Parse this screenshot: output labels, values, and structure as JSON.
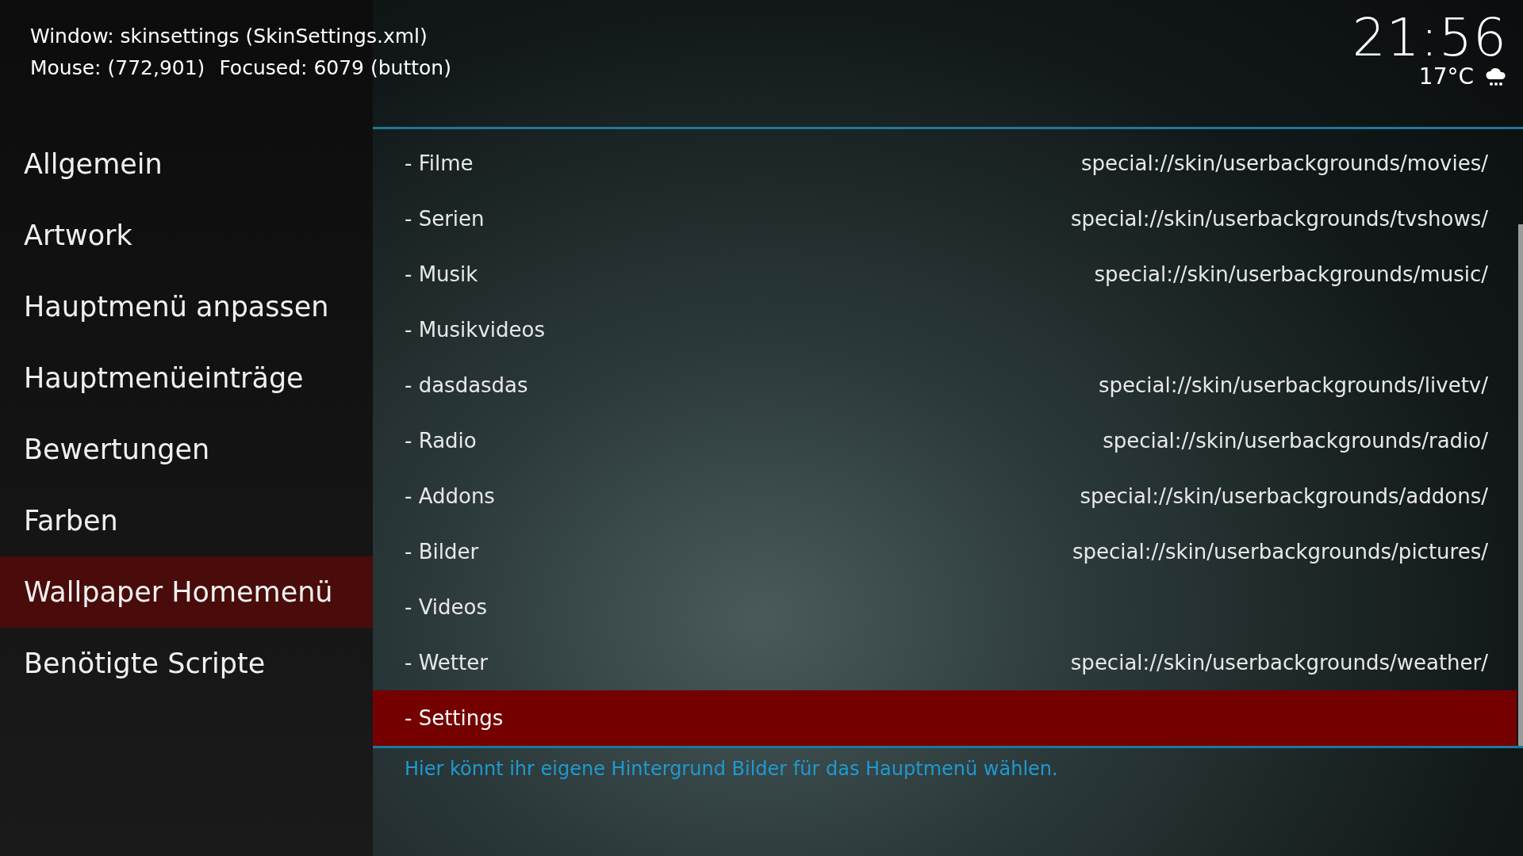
{
  "debug_overlay": {
    "window": "Window: skinsettings (SkinSettings.xml)",
    "mouse": "Mouse: (772,901)",
    "focused": "Focused: 6079 (button)"
  },
  "header": {
    "time": "21:56",
    "temperature": "17°C"
  },
  "sidebar": {
    "items": [
      {
        "label": "Allgemein",
        "selected": false
      },
      {
        "label": "Artwork",
        "selected": false
      },
      {
        "label": "Hauptmenü anpassen",
        "selected": false
      },
      {
        "label": "Hauptmenüeinträge",
        "selected": false
      },
      {
        "label": "Bewertungen",
        "selected": false
      },
      {
        "label": "Farben",
        "selected": false
      },
      {
        "label": "Wallpaper Homemenü",
        "selected": true
      },
      {
        "label": "Benötigte Scripte",
        "selected": false
      }
    ]
  },
  "settings_list": {
    "items": [
      {
        "label": "- Filme",
        "value": "special://skin/userbackgrounds/movies/",
        "selected": false
      },
      {
        "label": "- Serien",
        "value": "special://skin/userbackgrounds/tvshows/",
        "selected": false
      },
      {
        "label": "- Musik",
        "value": "special://skin/userbackgrounds/music/",
        "selected": false
      },
      {
        "label": "- Musikvideos",
        "selected": false
      },
      {
        "label": "- dasdasdas",
        "value": "special://skin/userbackgrounds/livetv/",
        "selected": false
      },
      {
        "label": "- Radio",
        "value": "special://skin/userbackgrounds/radio/",
        "selected": false
      },
      {
        "label": "- Addons",
        "value": "special://skin/userbackgrounds/addons/",
        "selected": false
      },
      {
        "label": "- Bilder",
        "value": "special://skin/userbackgrounds/pictures/",
        "selected": false
      },
      {
        "label": "- Videos",
        "selected": false
      },
      {
        "label": "- Wetter",
        "value": "special://skin/userbackgrounds/weather/",
        "selected": false
      },
      {
        "label": "- Settings",
        "selected": true
      }
    ]
  },
  "help_text": "Hier könnt ihr eigene Hintergrund Bilder für das Hauptmenü wählen."
}
